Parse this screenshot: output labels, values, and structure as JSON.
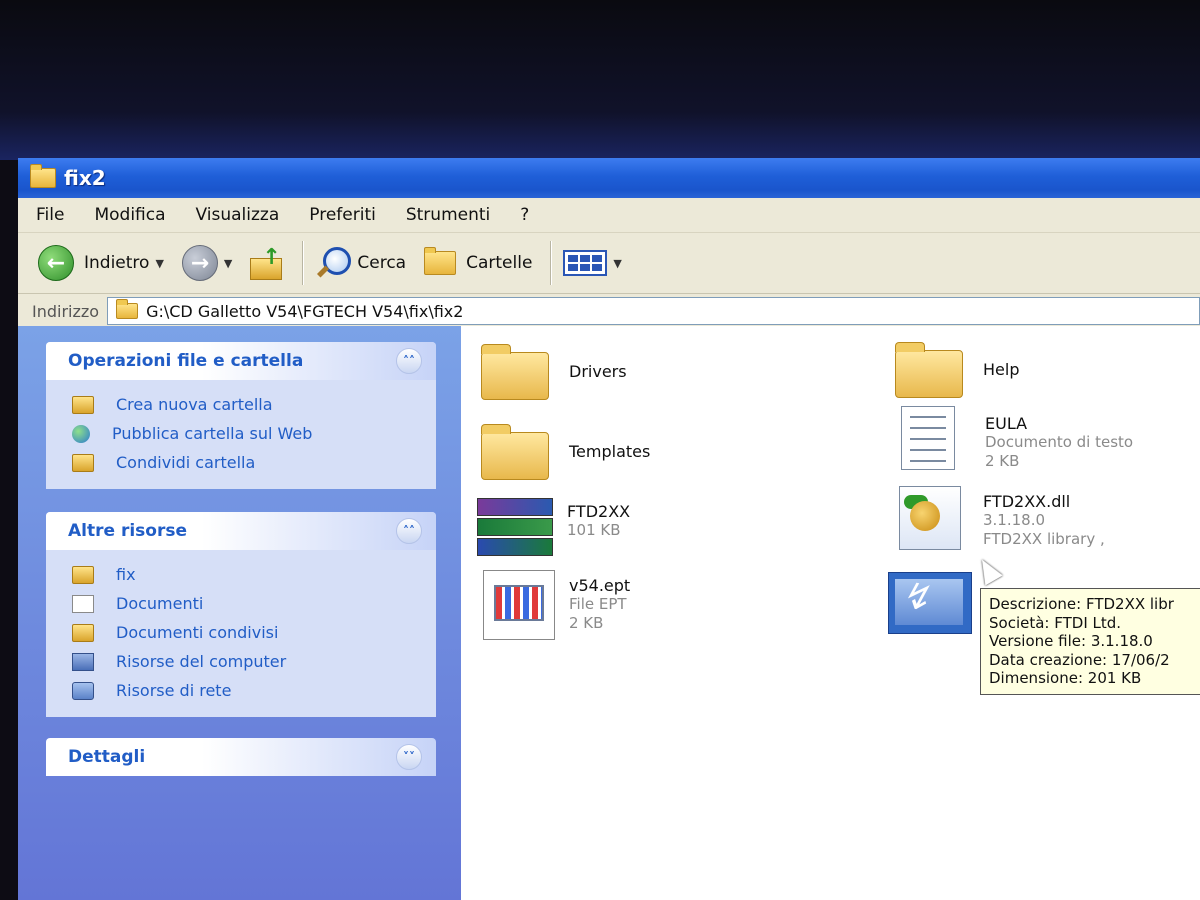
{
  "window": {
    "title": "fix2"
  },
  "menu": [
    "File",
    "Modifica",
    "Visualizza",
    "Preferiti",
    "Strumenti",
    "?"
  ],
  "toolbar": {
    "back_label": "Indietro",
    "search_label": "Cerca",
    "folders_label": "Cartelle"
  },
  "address": {
    "label": "Indirizzo",
    "path": "G:\\CD Galletto V54\\FGTECH V54\\fix\\fix2"
  },
  "sidebar": {
    "file_tasks": {
      "title": "Operazioni file e cartella",
      "items": [
        "Crea nuova cartella",
        "Pubblica cartella sul Web",
        "Condividi cartella"
      ]
    },
    "other_places": {
      "title": "Altre risorse",
      "items": [
        "fix",
        "Documenti",
        "Documenti condivisi",
        "Risorse del computer",
        "Risorse di rete"
      ]
    },
    "details": {
      "title": "Dettagli"
    }
  },
  "files": [
    {
      "name": "Drivers",
      "type": "folder"
    },
    {
      "name": "Help",
      "type": "folder"
    },
    {
      "name": "Templates",
      "type": "folder"
    },
    {
      "name": "EULA",
      "line2": "Documento di testo",
      "line3": "2 KB",
      "type": "text"
    },
    {
      "name": "FTD2XX",
      "line2": "101 KB",
      "type": "rar"
    },
    {
      "name": "FTD2XX.dll",
      "line2": "3.1.18.0",
      "line3": "FTD2XX library ,",
      "type": "dll"
    },
    {
      "name": "v54.ept",
      "line2": "File EPT",
      "line3": "2 KB",
      "type": "ept"
    }
  ],
  "tooltip": {
    "lines": [
      "Descrizione: FTD2XX libr",
      "Società: FTDI Ltd.",
      "Versione file: 3.1.18.0",
      "Data creazione: 17/06/2",
      "Dimensione: 201 KB"
    ]
  }
}
